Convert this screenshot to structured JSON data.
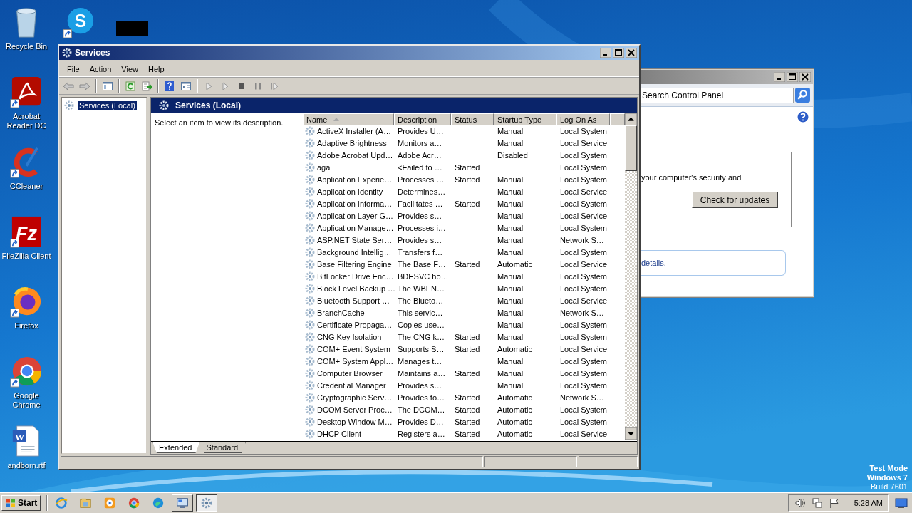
{
  "desktop": {
    "top_icons": [
      {
        "kind": "skype",
        "glyph": "S",
        "shortcut": true
      },
      {
        "kind": "redacted"
      }
    ],
    "icons": [
      {
        "kind": "recycle",
        "label": "Recycle Bin",
        "shortcut": false
      },
      {
        "kind": "acrobat",
        "label": "Acrobat Reader DC",
        "shortcut": true
      },
      {
        "kind": "ccleaner",
        "label": "CCleaner",
        "shortcut": true
      },
      {
        "kind": "filezilla",
        "label": "FileZilla Client",
        "glyph": "Fz",
        "shortcut": true
      },
      {
        "kind": "firefox",
        "label": "Firefox",
        "shortcut": true
      },
      {
        "kind": "chrome",
        "label": "Google Chrome",
        "shortcut": true
      },
      {
        "kind": "word",
        "label": "andborn.rtf",
        "glyph": "W",
        "shortcut": false
      }
    ],
    "system_text": [
      "Test Mode",
      "Windows 7",
      "Build 7601"
    ]
  },
  "control_panel": {
    "search": {
      "placeholder": "Search Control Panel"
    },
    "security_text": "your computer's security and",
    "update_button": "Check for updates",
    "info_text": "details."
  },
  "services_window": {
    "title": "Services",
    "menu": [
      "File",
      "Action",
      "View",
      "Help"
    ],
    "toolbar": [
      {
        "kind": "back"
      },
      {
        "kind": "forward"
      },
      {
        "kind": "separator"
      },
      {
        "kind": "tree"
      },
      {
        "kind": "separator"
      },
      {
        "kind": "refresh"
      },
      {
        "kind": "export"
      },
      {
        "kind": "separator"
      },
      {
        "kind": "help"
      },
      {
        "kind": "properties"
      },
      {
        "kind": "separator"
      },
      {
        "kind": "play"
      },
      {
        "kind": "play"
      },
      {
        "kind": "stop"
      },
      {
        "kind": "pause"
      },
      {
        "kind": "resume"
      }
    ],
    "tree": [
      {
        "label": "Services (Local)",
        "selected": true
      }
    ],
    "pane_title": "Services (Local)",
    "description": "Select an item to view its description.",
    "columns": [
      {
        "label": "Name",
        "sorted": true
      },
      {
        "label": "Description",
        "sorted": false
      },
      {
        "label": "Status",
        "sorted": false
      },
      {
        "label": "Startup Type",
        "sorted": false
      },
      {
        "label": "Log On As",
        "sorted": false
      }
    ],
    "rows": [
      {
        "name": "ActiveX Installer (A…",
        "description": "Provides U…",
        "startup_type": "Manual",
        "log_on_as": "Local System"
      },
      {
        "name": "Adaptive Brightness",
        "description": "Monitors a…",
        "startup_type": "Manual",
        "log_on_as": "Local Service"
      },
      {
        "name": "Adobe Acrobat Upd…",
        "description": "Adobe Acr…",
        "startup_type": "Disabled",
        "log_on_as": "Local System"
      },
      {
        "name": "aga",
        "description": "<Failed to …",
        "status": "Started",
        "log_on_as": "Local System"
      },
      {
        "name": "Application Experie…",
        "description": "Processes …",
        "status": "Started",
        "startup_type": "Manual",
        "log_on_as": "Local System"
      },
      {
        "name": "Application Identity",
        "description": "Determines…",
        "startup_type": "Manual",
        "log_on_as": "Local Service"
      },
      {
        "name": "Application Informa…",
        "description": "Facilitates …",
        "status": "Started",
        "startup_type": "Manual",
        "log_on_as": "Local System"
      },
      {
        "name": "Application Layer G…",
        "description": "Provides s…",
        "startup_type": "Manual",
        "log_on_as": "Local Service"
      },
      {
        "name": "Application Manage…",
        "description": "Processes i…",
        "startup_type": "Manual",
        "log_on_as": "Local System"
      },
      {
        "name": "ASP.NET State Ser…",
        "description": "Provides s…",
        "startup_type": "Manual",
        "log_on_as": "Network S…"
      },
      {
        "name": "Background Intellig…",
        "description": "Transfers f…",
        "startup_type": "Manual",
        "log_on_as": "Local System"
      },
      {
        "name": "Base Filtering Engine",
        "description": "The Base F…",
        "status": "Started",
        "startup_type": "Automatic",
        "log_on_as": "Local Service"
      },
      {
        "name": "BitLocker Drive Enc…",
        "description": "BDESVC ho…",
        "startup_type": "Manual",
        "log_on_as": "Local System"
      },
      {
        "name": "Block Level Backup …",
        "description": "The WBEN…",
        "startup_type": "Manual",
        "log_on_as": "Local System"
      },
      {
        "name": "Bluetooth Support …",
        "description": "The Blueto…",
        "startup_type": "Manual",
        "log_on_as": "Local Service"
      },
      {
        "name": "BranchCache",
        "description": "This servic…",
        "startup_type": "Manual",
        "log_on_as": "Network S…"
      },
      {
        "name": "Certificate Propaga…",
        "description": "Copies use…",
        "startup_type": "Manual",
        "log_on_as": "Local System"
      },
      {
        "name": "CNG Key Isolation",
        "description": "The CNG k…",
        "status": "Started",
        "startup_type": "Manual",
        "log_on_as": "Local System"
      },
      {
        "name": "COM+ Event System",
        "description": "Supports S…",
        "status": "Started",
        "startup_type": "Automatic",
        "log_on_as": "Local Service"
      },
      {
        "name": "COM+ System Appl…",
        "description": "Manages t…",
        "startup_type": "Manual",
        "log_on_as": "Local System"
      },
      {
        "name": "Computer Browser",
        "description": "Maintains a…",
        "status": "Started",
        "startup_type": "Manual",
        "log_on_as": "Local System"
      },
      {
        "name": "Credential Manager",
        "description": "Provides s…",
        "startup_type": "Manual",
        "log_on_as": "Local System"
      },
      {
        "name": "Cryptographic Serv…",
        "description": "Provides fo…",
        "status": "Started",
        "startup_type": "Automatic",
        "log_on_as": "Network S…"
      },
      {
        "name": "DCOM Server Proc…",
        "description": "The DCOM…",
        "status": "Started",
        "startup_type": "Automatic",
        "log_on_as": "Local System"
      },
      {
        "name": "Desktop Window M…",
        "description": "Provides D…",
        "status": "Started",
        "startup_type": "Automatic",
        "log_on_as": "Local System"
      },
      {
        "name": "DHCP Client",
        "description": "Registers a…",
        "status": "Started",
        "startup_type": "Automatic",
        "log_on_as": "Local Service"
      }
    ],
    "tabs": [
      {
        "label": "Extended",
        "selected": true
      },
      {
        "label": "Standard",
        "selected": false
      }
    ]
  },
  "taskbar": {
    "start": "Start",
    "quick_launch": [
      {
        "kind": "ie"
      },
      {
        "kind": "explorer"
      },
      {
        "kind": "media"
      },
      {
        "kind": "chrome"
      },
      {
        "kind": "edge"
      }
    ],
    "windows": [
      {
        "kind": "control-panel",
        "active": false
      },
      {
        "kind": "services",
        "active": true
      }
    ],
    "tray": [
      {
        "kind": "volume"
      },
      {
        "kind": "network"
      },
      {
        "kind": "flag"
      }
    ],
    "clock": "5:28 AM"
  }
}
